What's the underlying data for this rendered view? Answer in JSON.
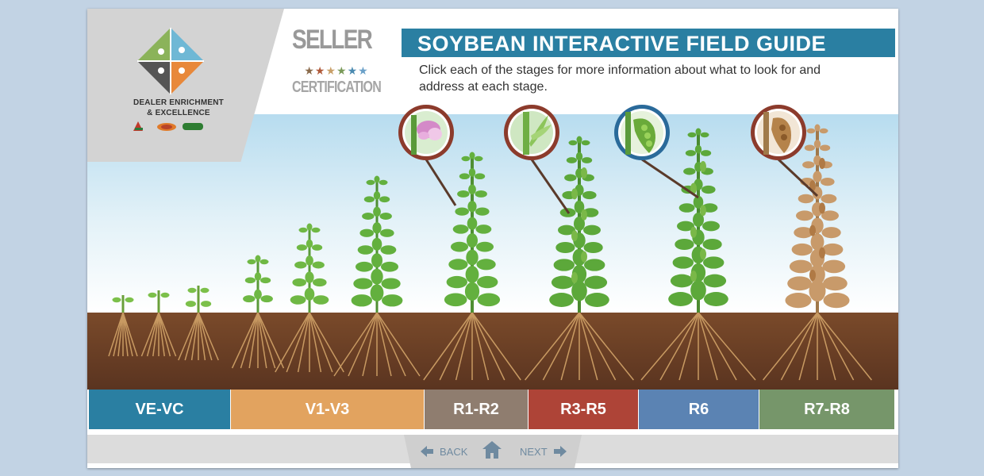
{
  "header": {
    "logo_lines": [
      "DEALER ENRICHMENT",
      "& EXCELLENCE"
    ],
    "seller_title": "SELLER",
    "seller_subtitle": "CERTIFICATION",
    "star_colors": [
      "#8a6a4a",
      "#b05a3a",
      "#c9a06a",
      "#7a9a5a",
      "#4a8ab0",
      "#6aa0c8"
    ],
    "guide_title": "SOYBEAN INTERACTIVE FIELD GUIDE",
    "instructions": "Click each of the stages for more information about what to look for and address at each stage."
  },
  "stages": [
    {
      "label": "VE-VC",
      "color": "#2a7fa2"
    },
    {
      "label": "V1-V3",
      "color": "#e2a35f"
    },
    {
      "label": "R1-R2",
      "color": "#8f7d6f"
    },
    {
      "label": "R3-R5",
      "color": "#ae4437"
    },
    {
      "label": "R6",
      "color": "#5b83b3"
    },
    {
      "label": "R7-R8",
      "color": "#76966a"
    }
  ],
  "callouts": [
    {
      "name": "flower-callout-icon",
      "subject": "flower"
    },
    {
      "name": "pod-leaf-callout-icon",
      "subject": "young pod"
    },
    {
      "name": "green-pod-callout-icon",
      "subject": "green pod"
    },
    {
      "name": "mature-pod-callout-icon",
      "subject": "mature pod"
    }
  ],
  "navigation": {
    "back_label": "BACK",
    "next_label": "NEXT",
    "home_icon": "home-icon"
  }
}
